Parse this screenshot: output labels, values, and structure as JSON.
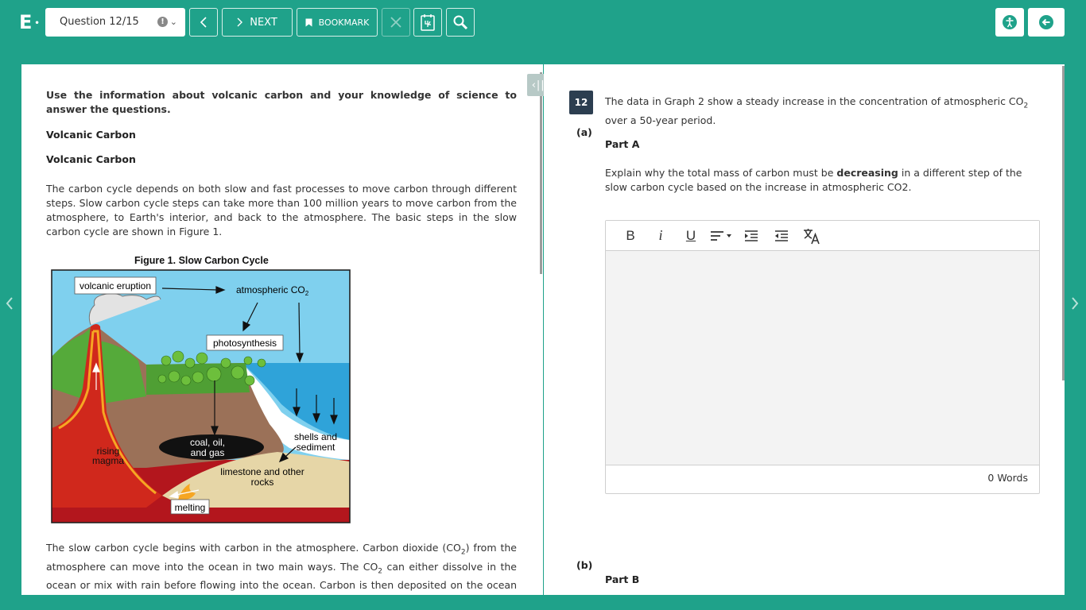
{
  "app": {
    "logo": "E",
    "logo_dot": "•"
  },
  "toolbar": {
    "question_select": "Question 12/15",
    "warn_glyph": "!",
    "next_label": "NEXT",
    "bookmark_label": "BOOKMARK"
  },
  "stimulus": {
    "intro": "Use the information about volcanic carbon and your knowledge of science to answer the questions.",
    "heading1": "Volcanic Carbon",
    "heading2": "Volcanic Carbon",
    "para1": "The carbon cycle depends on both slow and fast processes to move carbon through different steps. Slow carbon cycle steps can take more than 100 million years to move carbon from the atmosphere, to Earth's interior, and back to the atmosphere. The basic steps in the slow carbon cycle are shown in Figure 1.",
    "figure_title": "Figure 1. Slow Carbon Cycle",
    "figure_labels": {
      "volcanic_eruption": "volcanic eruption",
      "atmospheric_co2": "atmospheric CO",
      "co2_sub": "2",
      "photosynthesis": "photosynthesis",
      "coal_line1": "coal, oil,",
      "coal_line2": "and gas",
      "shells_line1": "shells and",
      "shells_line2": "sediment",
      "rising_line1": "rising",
      "rising_line2": "magma",
      "limestone_line1": "limestone and other",
      "limestone_line2": "rocks",
      "melting": "melting"
    },
    "para2_a": "The slow carbon cycle begins with carbon in the atmosphere. Carbon dioxide (CO",
    "para2_sub1": "2",
    "para2_b": ") from the atmosphere can move into the ocean in two main ways. The CO",
    "para2_sub2": "2",
    "para2_c": " can either dissolve in the ocean or mix with rain before flowing into the ocean. Carbon is then deposited on the ocean floor in the form of shells and sediment. The carbon on the ocean floor turns into rock beneath Earth's surface over"
  },
  "question": {
    "number": "12",
    "stem_a": "The data in Graph 2 show a steady increase in the concentration of atmospheric CO",
    "stem_sub": "2",
    "stem_b": " over a 50-year period.",
    "part_a_letter": "(a)",
    "part_a_title": "Part A",
    "prompt_a": "Explain why the total mass of carbon must be ",
    "prompt_bold": "decreasing",
    "prompt_b": " in a different step of the slow carbon cycle based on the increase in atmospheric CO2.",
    "word_count": "0 Words",
    "part_b_letter": "(b)",
    "part_b_title": "Part B"
  },
  "editor_tools": {
    "bold": "B",
    "italic": "i",
    "underline": "U"
  },
  "colors": {
    "brand": "#1fa28a",
    "qnum_bg": "#2c3e50"
  }
}
